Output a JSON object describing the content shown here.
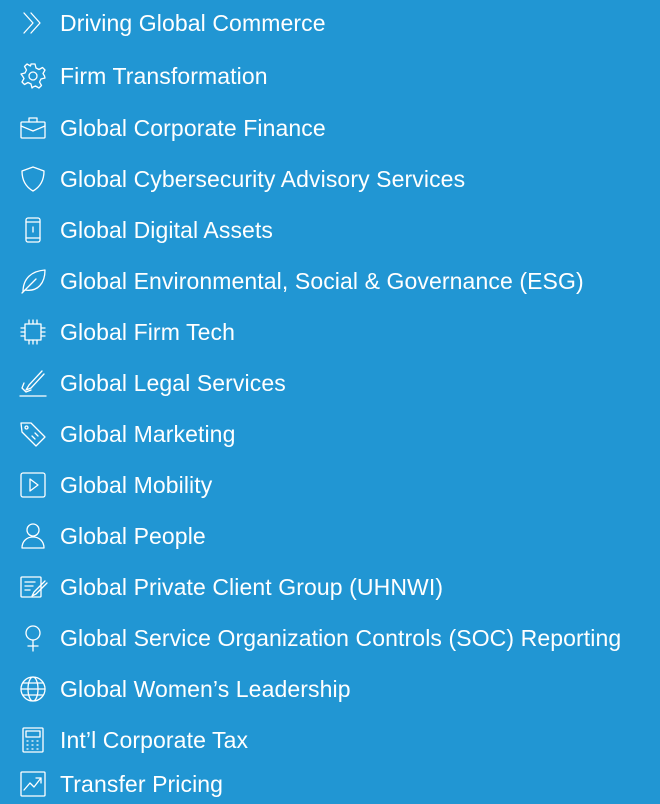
{
  "colors": {
    "background": "#2196d3",
    "text": "#ffffff"
  },
  "items": [
    {
      "label": "Driving Global Commerce",
      "icon": "double-chevron-right-icon"
    },
    {
      "label": "Firm Transformation",
      "icon": "gear-icon"
    },
    {
      "label": "Global Corporate Finance",
      "icon": "briefcase-icon"
    },
    {
      "label": "Global Cybersecurity Advisory Services",
      "icon": "shield-icon"
    },
    {
      "label": "Global Digital Assets",
      "icon": "mobile-phone-icon"
    },
    {
      "label": "Global Environmental, Social & Governance (ESG)",
      "icon": "leaf-icon"
    },
    {
      "label": "Global Firm Tech",
      "icon": "chip-icon"
    },
    {
      "label": "Global Legal Services",
      "icon": "pen-signature-icon"
    },
    {
      "label": "Global Marketing",
      "icon": "tag-icon"
    },
    {
      "label": "Global Mobility",
      "icon": "play-button-icon"
    },
    {
      "label": "Global People",
      "icon": "person-icon"
    },
    {
      "label": "Global Private Client Group (UHNWI)",
      "icon": "document-edit-icon"
    },
    {
      "label": "Global Service Organization Controls (SOC) Reporting",
      "icon": "female-symbol-icon"
    },
    {
      "label": "Global Women’s Leadership",
      "icon": "globe-icon"
    },
    {
      "label": "Int’l Corporate Tax",
      "icon": "calculator-icon"
    },
    {
      "label": "Transfer Pricing",
      "icon": "trend-chart-icon"
    }
  ]
}
